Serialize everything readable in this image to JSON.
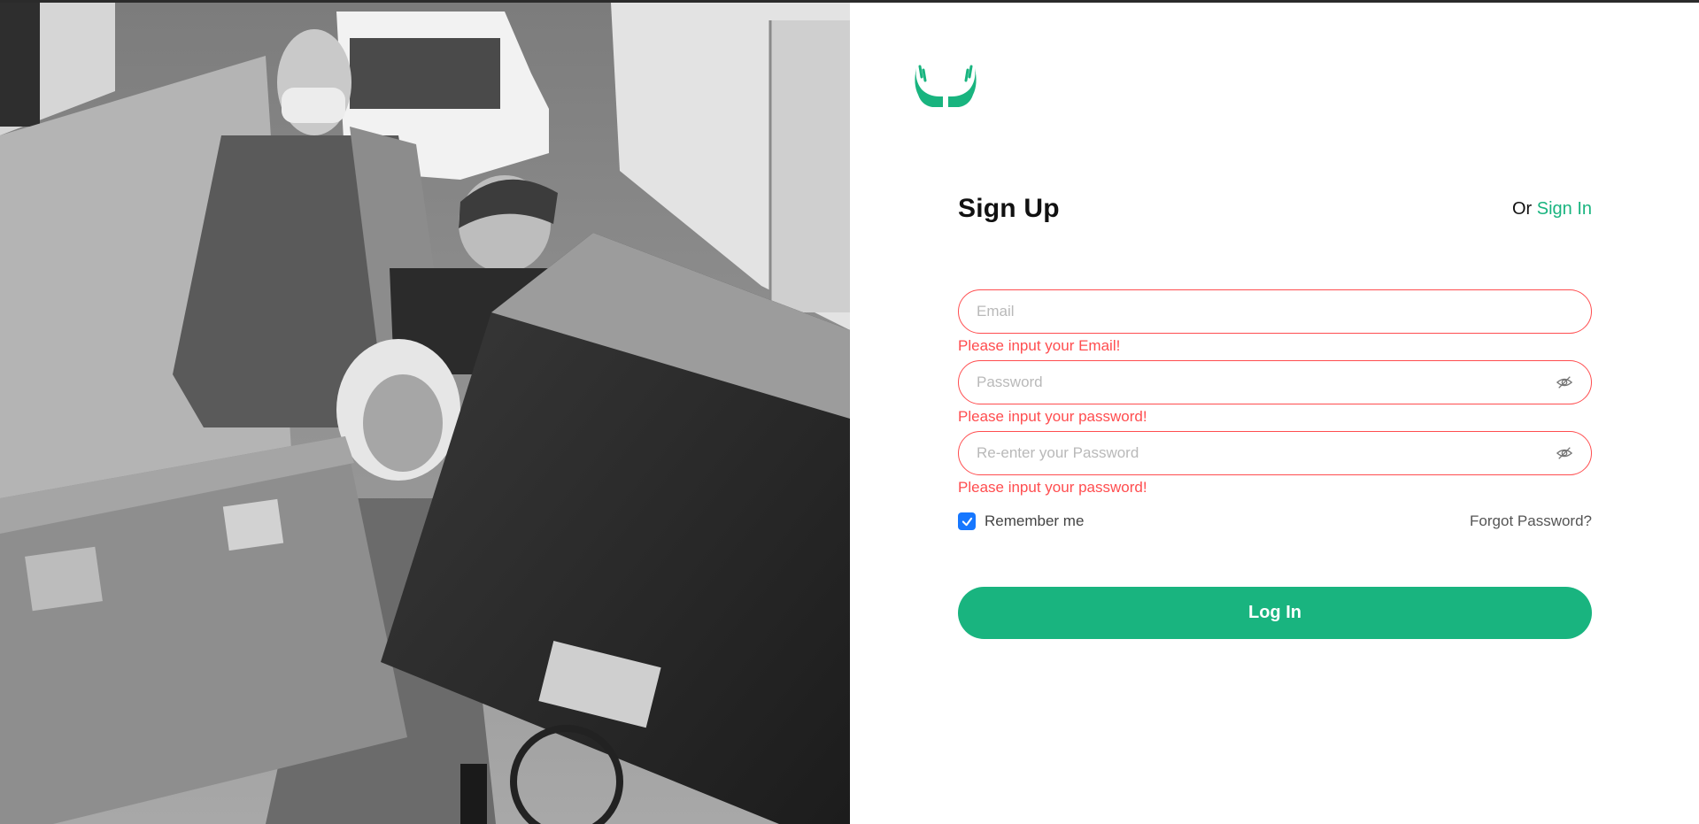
{
  "brand": {
    "logo_icon": "caring-hands-icon",
    "accent_color": "#19b47f"
  },
  "header": {
    "title": "Sign Up",
    "or_text": "Or",
    "signin_link": "Sign In"
  },
  "form": {
    "email": {
      "placeholder": "Email",
      "value": "",
      "error": "Please input your Email!"
    },
    "password": {
      "placeholder": "Password",
      "value": "",
      "error": "Please input your password!"
    },
    "confirm_password": {
      "placeholder": "Re-enter your Password",
      "value": "",
      "error": "Please input your password!"
    },
    "remember_label": "Remember me",
    "remember_checked": true,
    "forgot_label": "Forgot Password?",
    "submit_label": "Log In"
  },
  "photo": {
    "icon": "volunteers-photo"
  },
  "colors": {
    "error": "#ff4d4f",
    "checkbox": "#1677ff",
    "button": "#19b47f"
  }
}
